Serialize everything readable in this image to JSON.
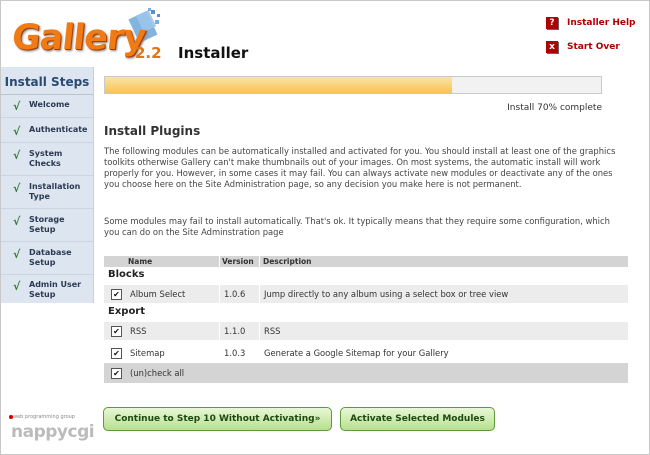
{
  "header": {
    "logo_word": "Gallery",
    "version": "2.2",
    "installer_label": "Installer",
    "links": [
      {
        "icon": "?",
        "label": "Installer Help"
      },
      {
        "icon": "x",
        "label": "Start Over"
      }
    ]
  },
  "sidebar": {
    "title": "Install Steps",
    "steps": [
      {
        "label": "Welcome",
        "done": true
      },
      {
        "label": "Authenticate",
        "done": true
      },
      {
        "label": "System Checks",
        "done": true
      },
      {
        "label": "Installation Type",
        "done": true
      },
      {
        "label": "Storage Setup",
        "done": true
      },
      {
        "label": "Database Setup",
        "done": true
      },
      {
        "label": "Admin User Setup",
        "done": true
      }
    ]
  },
  "progress": {
    "percent": 70,
    "label": "Install 70% complete"
  },
  "main": {
    "title": "Install Plugins",
    "paragraph1": "The following modules can be automatically installed and activated for you. You should install at least one of the graphics toolkits otherwise Gallery can't make thumbnails out of your images. On most systems, the automatic install will work properly for you. However, in some cases it may fail. You can always activate new modules or deactivate any of the ones you choose here on the Site Administration page, so any decision you make here is not permanent.",
    "paragraph2": "Some modules may fail to install automatically. That's ok. It typically means that they require some configuration, which you can do on the Site Adminstration page"
  },
  "table": {
    "headers": {
      "name": "Name",
      "version": "Version",
      "description": "Description"
    },
    "groups": [
      {
        "title": "Blocks",
        "rows": [
          {
            "checked": true,
            "name": "Album Select",
            "version": "1.0.6",
            "description": "Jump directly to any album using a select box or tree view"
          }
        ]
      },
      {
        "title": "Export",
        "rows": [
          {
            "checked": true,
            "name": "RSS",
            "version": "1.1.0",
            "description": "RSS"
          },
          {
            "checked": true,
            "name": "Sitemap",
            "version": "1.0.3",
            "description": "Generate a Google Sitemap for your Gallery"
          }
        ]
      }
    ],
    "toggle_label": "(un)check all",
    "toggle_checked": true
  },
  "buttons": {
    "continue": "Continue to Step 10 Without Activating»",
    "activate": "Activate Selected Modules"
  },
  "footer": {
    "tagline": "web programming group",
    "brand": "nappycgi"
  }
}
